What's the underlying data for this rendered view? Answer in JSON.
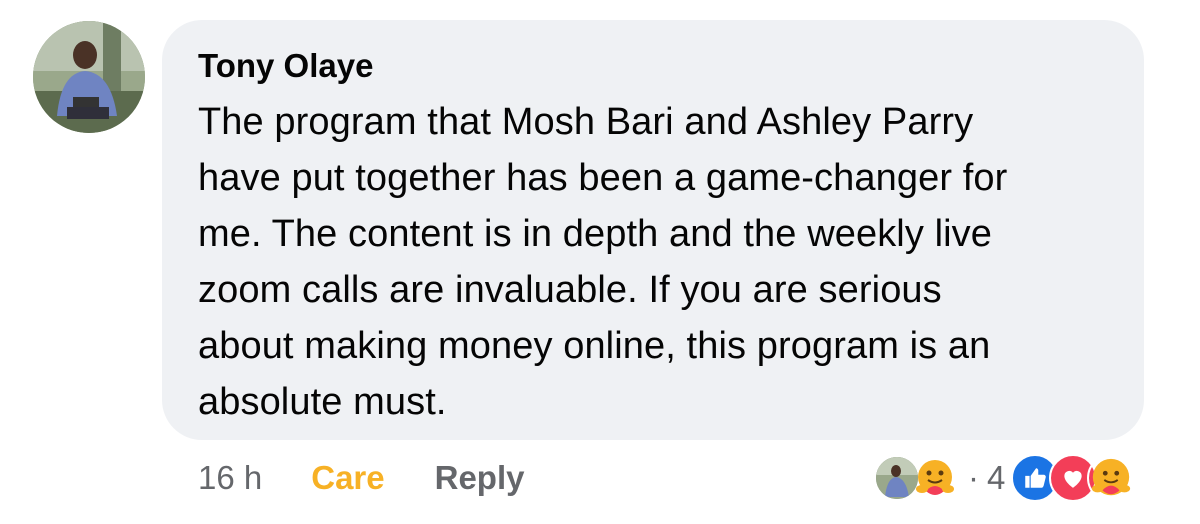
{
  "comment": {
    "author": "Tony Olaye",
    "text_lines": [
      "The program that Mosh Bari and Ashley Parry",
      "have put together has been a game-changer for",
      "me. The content is in depth and the weekly live",
      "zoom calls are invaluable. If you are serious",
      "about making money online, this program is an",
      "absolute must."
    ],
    "timestamp": "16 h",
    "reaction_label": "Care",
    "reply_label": "Reply",
    "separator": "·",
    "reaction_count": "4"
  },
  "colors": {
    "bubble_bg": "#eff1f4",
    "text": "#050505",
    "muted": "#65676b",
    "care": "#f7b125",
    "like": "#1b74e4",
    "love": "#f33e58"
  },
  "icons": {
    "avatar": "profile-photo",
    "user_reaction": "care-emoji",
    "summary": [
      "like-icon",
      "love-icon",
      "care-icon"
    ]
  }
}
